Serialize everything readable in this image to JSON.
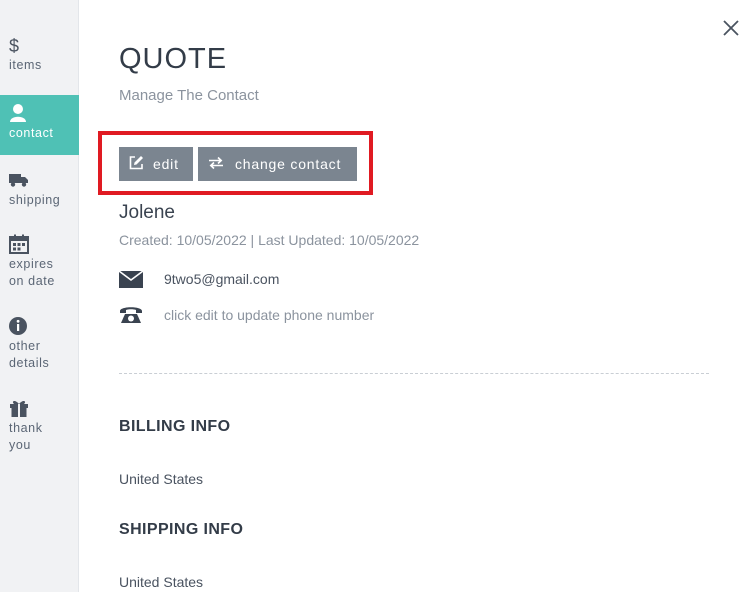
{
  "sidebar": {
    "items": [
      {
        "label": "items",
        "icon": "dollar-icon"
      },
      {
        "label": "contact",
        "icon": "person-icon",
        "active": true
      },
      {
        "label": "shipping",
        "icon": "truck-icon"
      },
      {
        "label": "expires\non date",
        "icon": "calendar-icon"
      },
      {
        "label": "other\ndetails",
        "icon": "info-icon"
      },
      {
        "label": "thank\nyou",
        "icon": "gift-icon"
      }
    ],
    "active_color": "#4fc1b5"
  },
  "panel": {
    "title": "QUOTE",
    "subtitle": "Manage The Contact"
  },
  "actions": {
    "edit_label": "edit",
    "change_contact_label": "change contact",
    "highlight_color": "#e01a22"
  },
  "contact": {
    "name": "Jolene",
    "dates": "Created: 10/05/2022 | Last Updated: 10/05/2022",
    "email": "9two5@gmail.com",
    "phone_placeholder": "click edit to update phone number"
  },
  "billing": {
    "title": "BILLING INFO",
    "country": "United States"
  },
  "shipping": {
    "title": "SHIPPING INFO",
    "country": "United States"
  }
}
